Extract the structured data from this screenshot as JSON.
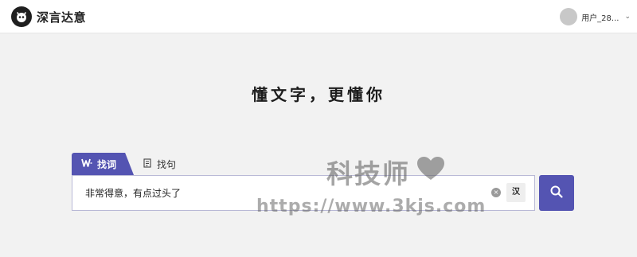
{
  "header": {
    "brand": "深言达意",
    "user_name": "用户_28...",
    "dropdown_glyph": "⌄"
  },
  "slogan": "懂文字，更懂你",
  "tabs": [
    {
      "label": "找词",
      "icon": "w-icon",
      "active": true
    },
    {
      "label": "找句",
      "icon": "doc-icon",
      "active": false
    }
  ],
  "search": {
    "value": "非常得意，有点过头了",
    "clear_glyph": "×",
    "han_label": "汉"
  },
  "watermark": {
    "title": "科技师",
    "url": "https://www.3kjs.com"
  },
  "colors": {
    "accent": "#5454b2",
    "background": "#f2f2f2",
    "header_bg": "#ffffff"
  }
}
